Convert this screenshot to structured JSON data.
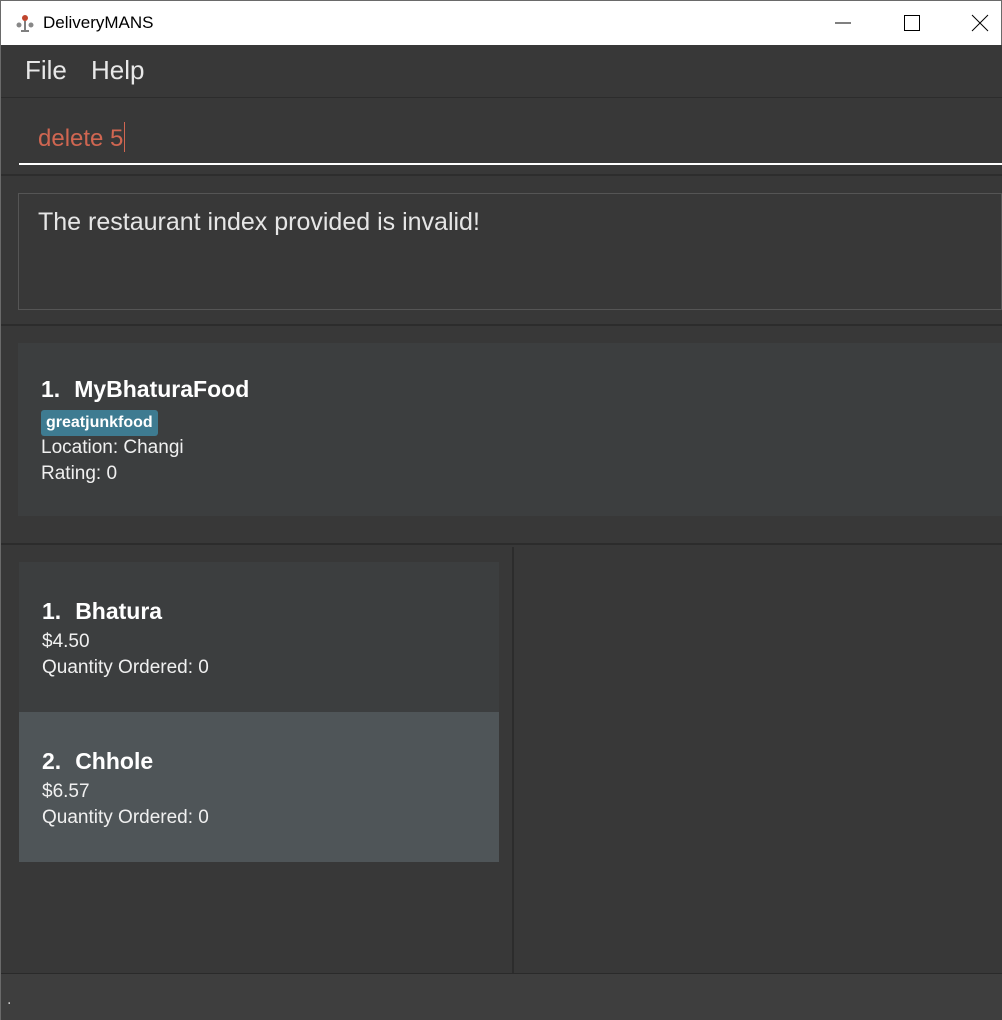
{
  "window": {
    "title": "DeliveryMANS",
    "icon": "delivery-app-icon"
  },
  "menu": {
    "file": "File",
    "help": "Help"
  },
  "command": {
    "value": "delete 5"
  },
  "result": {
    "message": "The restaurant index provided is invalid!"
  },
  "restaurants": [
    {
      "index": "1.",
      "name": "MyBhaturaFood",
      "tag": "greatjunkfood",
      "location": "Location: Changi",
      "rating": "Rating: 0"
    }
  ],
  "menu_items": [
    {
      "index": "1.",
      "name": "Bhatura",
      "price": "$4.50",
      "quantity": "Quantity Ordered: 0",
      "selected": false
    },
    {
      "index": "2.",
      "name": "Chhole",
      "price": "$6.57",
      "quantity": "Quantity Ordered: 0",
      "selected": true
    }
  ],
  "status": {
    "text": "."
  },
  "colors": {
    "background": "#383838",
    "card": "#3c3e3f",
    "selected_card": "#4f5558",
    "tag": "#3e7b91",
    "command_text": "#d06651"
  }
}
